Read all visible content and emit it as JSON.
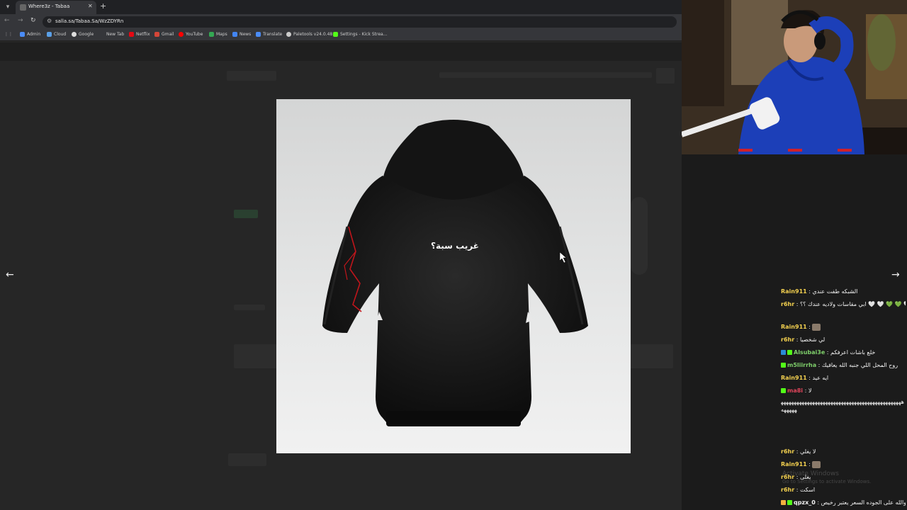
{
  "browser": {
    "tab_title": "Where3z - Tabaa",
    "url": "salla.sa/Tabaa.Sa/WzZDYRn",
    "bookmarks": [
      {
        "label": "Admin",
        "color": "#4a8cf7"
      },
      {
        "label": "Cloud",
        "color": "#5aa0e8"
      },
      {
        "label": "Google",
        "color": "#dddddd"
      },
      {
        "label": "New Tab",
        "color": "#35363a"
      },
      {
        "label": "Netflix",
        "color": "#e50914"
      },
      {
        "label": "Gmail",
        "color": "#d44638"
      },
      {
        "label": "YouTube",
        "color": "#ff0000"
      },
      {
        "label": "Maps",
        "color": "#34a853"
      },
      {
        "label": "News",
        "color": "#4285f4"
      },
      {
        "label": "Translate",
        "color": "#4a8cf7"
      },
      {
        "label": "Paletools v24.0.48",
        "color": "#cccccc"
      },
      {
        "label": "Settings - Kick Strea...",
        "color": "#53fc18"
      }
    ]
  },
  "product": {
    "hoodie_print": "غريب سبة؟"
  },
  "chat": {
    "messages": [
      {
        "user": "Rain911",
        "user_color": "#f3d04f",
        "text": "الشبكه طفت عندي",
        "badges": []
      },
      {
        "user": "r6hr",
        "user_color": "#f3d04f",
        "text": "ابي مقاسات ولاديه عندك ؟؟ 🤍 🤍 💚 💚 🤍",
        "badges": []
      },
      {
        "user": "Rain911",
        "user_color": "#f3d04f",
        "text": "",
        "badges": [],
        "emote": true
      },
      {
        "user": "r6hr",
        "user_color": "#f3d04f",
        "text": "لي شخصيا",
        "badges": []
      },
      {
        "user": "Alsubai3e",
        "user_color": "#7fd06b",
        "text": "خلع باشات اعرفكم",
        "badges": [
          "#2a8cd7",
          "#53fc18"
        ]
      },
      {
        "user": "m5liirrha",
        "user_color": "#7fd06b",
        "text": "روح المحل اللي جنبه الله يعافيك",
        "badges": [
          "#53fc18"
        ]
      },
      {
        "user": "Rain911",
        "user_color": "#f3d04f",
        "text": "ايه عيد",
        "badges": []
      },
      {
        "user": "ma8i",
        "user_color": "#e0455b",
        "text": "لا",
        "badges": [
          "#53fc18"
        ]
      },
      {
        "user": "",
        "user_color": "#f2f2f2",
        "text": "ههههههههههههههههههههههههههههههههههههههههههههههههههههه",
        "badges": []
      },
      {
        "user": "r6hr",
        "user_color": "#f3d04f",
        "text": "لا يغلي",
        "badges": []
      },
      {
        "user": "Rain911",
        "user_color": "#f3d04f",
        "text": "",
        "badges": [],
        "emote": true
      },
      {
        "user": "r6hr",
        "user_color": "#f3d04f",
        "text": "يغلى",
        "badges": []
      },
      {
        "user": "r6hr",
        "user_color": "#f3d04f",
        "text": "اسكت",
        "badges": []
      },
      {
        "user": "qpzx_0",
        "user_color": "#f2f2f2",
        "text": "والله على الجوده السعر يعتبر رخيص",
        "badges": [
          "#f3b03f",
          "#53fc18"
        ]
      }
    ],
    "watermark_title": "Activate Windows",
    "watermark_sub": "Go to Settings to activate Windows."
  }
}
